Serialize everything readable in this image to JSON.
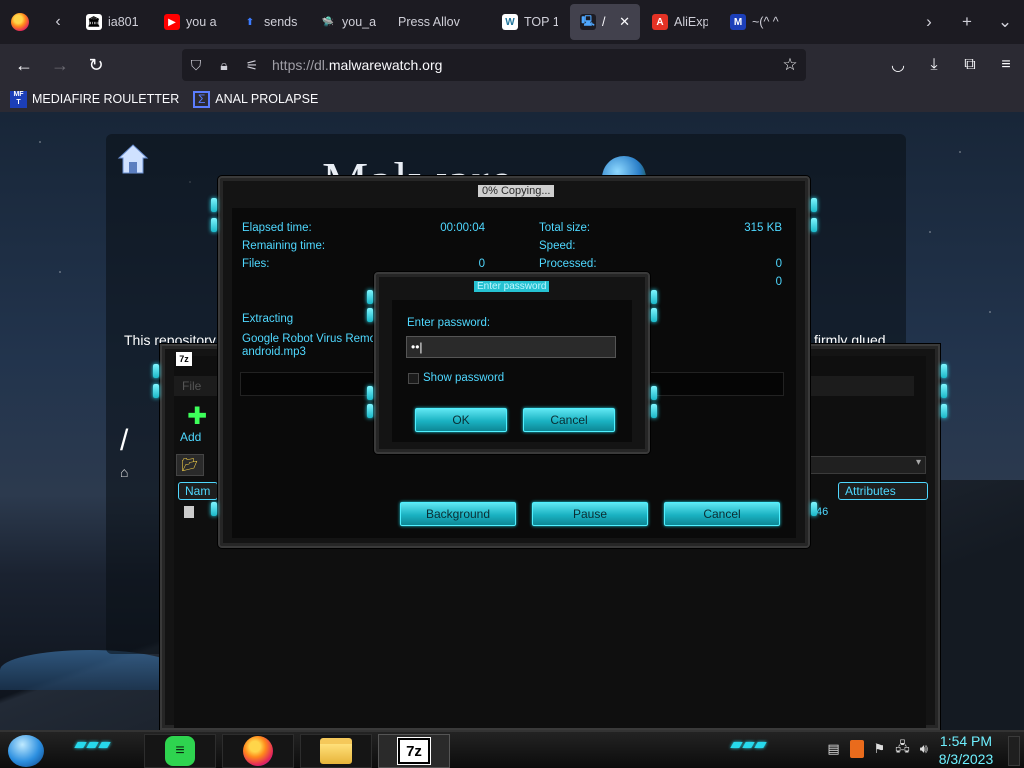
{
  "browser": {
    "tabs": [
      {
        "icon": "archive-org-icon",
        "label": "ia801",
        "fav_bg": "#ffffff",
        "fav_fg": "#000000",
        "fav_glyph": "🏛"
      },
      {
        "icon": "youtube-icon",
        "label": "you a",
        "fav_bg": "#ff0000",
        "fav_fg": "#ffffff",
        "fav_glyph": "▶"
      },
      {
        "icon": "sendspace-icon",
        "label": "sends",
        "fav_bg": "#1c1b22",
        "fav_fg": "#3b7bff",
        "fav_glyph": "⬆"
      },
      {
        "icon": "ufo-icon",
        "label": "you_a",
        "fav_bg": "#1c1b22",
        "fav_fg": "#cfcfcf",
        "fav_glyph": "🛸"
      },
      {
        "icon": "",
        "label": "Press Allov",
        "fav_bg": "",
        "fav_fg": "",
        "fav_glyph": ""
      },
      {
        "icon": "wordpress-icon",
        "label": "TOP 1",
        "fav_bg": "#ffffff",
        "fav_fg": "#21759b",
        "fav_glyph": "W"
      },
      {
        "icon": "malwarewatch-icon",
        "label": "/ –",
        "fav_bg": "#1c1b22",
        "fav_fg": "#4fa8ff",
        "fav_glyph": "🖳",
        "active": true
      },
      {
        "icon": "aliexpress-icon",
        "label": "AliExp",
        "fav_bg": "#e43225",
        "fav_fg": "#ffffff",
        "fav_glyph": "A"
      },
      {
        "icon": "mediafire-icon",
        "label": "~(^ ^",
        "fav_bg": "#1c3fb8",
        "fav_fg": "#ffffff",
        "fav_glyph": "M"
      }
    ],
    "url_host": "https://dl.",
    "url_domain": "malwarewatch.org",
    "bookmarks": [
      {
        "label": "MEDIAFIRE ROULETTER"
      },
      {
        "label": "ANAL PROLAPSE"
      }
    ]
  },
  "site": {
    "logo_text": "Malware",
    "left_text": "This repository",
    "right_text": "firmly glued"
  },
  "file_manager": {
    "icon_label": "7z",
    "menu_file": "File",
    "add_label": "Add",
    "col_name": "Nam",
    "col_attributes": "Attributes",
    "row_value": "46",
    "path": "/"
  },
  "copy_dialog": {
    "title": "0% Copying...",
    "elapsed_label": "Elapsed time:",
    "elapsed_value": "00:00:04",
    "remaining_label": "Remaining time:",
    "files_label": "Files:",
    "files_value": "0",
    "total_size_label": "Total size:",
    "total_size_value": "315 KB",
    "speed_label": "Speed:",
    "processed_label": "Processed:",
    "processed_value": "0",
    "extra_value": "0",
    "extracting_label": "Extracting",
    "extracting_file": "Google Robot Virus Remova",
    "extracting_file2": "android.mp3",
    "progress": 0,
    "background_btn": "Background",
    "pause_btn": "Pause",
    "cancel_btn": "Cancel"
  },
  "password_dialog": {
    "title": "Enter password",
    "prompt": "Enter password:",
    "value": "••|",
    "show_password_label": "Show password",
    "show_password_checked": false,
    "ok_btn": "OK",
    "cancel_btn": "Cancel"
  },
  "taskbar": {
    "apps": [
      {
        "name": "spotify",
        "glyph": "≡"
      },
      {
        "name": "firefox"
      },
      {
        "name": "file-explorer"
      },
      {
        "name": "7zip",
        "label": "7z",
        "active": true
      }
    ],
    "time": "1:54 PM",
    "date": "8/3/2023"
  }
}
